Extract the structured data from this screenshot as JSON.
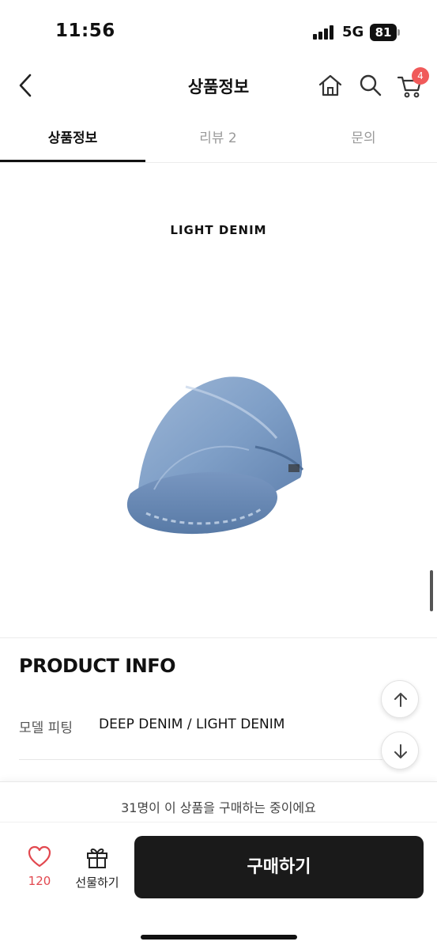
{
  "status_bar": {
    "time": "11:56",
    "network": "5G",
    "battery": "81"
  },
  "header": {
    "title": "상품정보",
    "cart_count": "4",
    "icons": [
      "back-icon",
      "home-icon",
      "search-icon",
      "cart-icon"
    ]
  },
  "tabs": [
    {
      "label": "상품정보",
      "active": true
    },
    {
      "label": "리뷰 2",
      "active": false
    },
    {
      "label": "문의",
      "active": false
    }
  ],
  "product_image": {
    "caption": "LIGHT DENIM"
  },
  "product_info": {
    "title": "PRODUCT INFO",
    "rows": [
      {
        "label": "모델 피팅",
        "value": "DEEP DENIM / LIGHT DENIM"
      }
    ]
  },
  "bottom_bar": {
    "notice": "31명이 이 상품을 구매하는 중이에요",
    "like_count": "120",
    "gift_label": "선물하기",
    "buy_label": "구매하기"
  },
  "colors": {
    "accent_red": "#e2484f",
    "badge_red": "#f05a5a",
    "buy_button": "#1a1a1a",
    "denim": "#7f9fc7"
  }
}
